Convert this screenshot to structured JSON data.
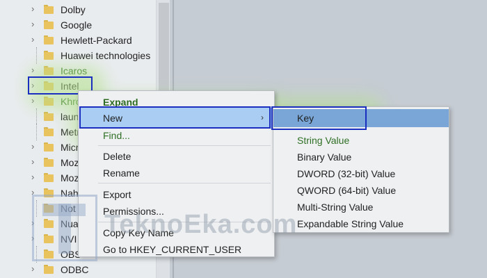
{
  "tree": {
    "items": [
      {
        "label": "Dolby",
        "expandable": true
      },
      {
        "label": "Google",
        "expandable": true
      },
      {
        "label": "Hewlett-Packard",
        "expandable": true
      },
      {
        "label": "Huawei technologies",
        "expandable": false
      },
      {
        "label": "Icaros",
        "expandable": true
      },
      {
        "label": "Intel",
        "expandable": true
      },
      {
        "label": "Khro",
        "expandable": true
      },
      {
        "label": "laun",
        "expandable": false
      },
      {
        "label": "Metr",
        "expandable": false
      },
      {
        "label": "Micr",
        "expandable": true
      },
      {
        "label": "Moz",
        "expandable": true
      },
      {
        "label": "Moz",
        "expandable": true
      },
      {
        "label": "Nah",
        "expandable": true
      },
      {
        "label": "Not",
        "expandable": false
      },
      {
        "label": "Nua",
        "expandable": true
      },
      {
        "label": "NVI",
        "expandable": true
      },
      {
        "label": "OBS",
        "expandable": false
      },
      {
        "label": "ODBC",
        "expandable": true
      }
    ]
  },
  "context_menu": {
    "expand": "Expand",
    "new": "New",
    "find": "Find...",
    "delete": "Delete",
    "rename": "Rename",
    "export": "Export",
    "permissions": "Permissions...",
    "copy_key_name": "Copy Key Name",
    "goto": "Go to HKEY_CURRENT_USER",
    "submenu_arrow": "›"
  },
  "new_submenu": {
    "key": "Key",
    "string_value": "String Value",
    "binary_value": "Binary Value",
    "dword_value": "DWORD (32-bit) Value",
    "qword_value": "QWORD (64-bit) Value",
    "multi_string_value": "Multi-String Value",
    "expandable_string_value": "Expandable String Value"
  },
  "watermark": {
    "text": "TeknoEka.com"
  },
  "colors": {
    "highlight_box": "#1a2fbf",
    "menu_hover": "#a9cdf3",
    "key_selected": "#79a6d6",
    "green_text": "#2f6f24"
  }
}
